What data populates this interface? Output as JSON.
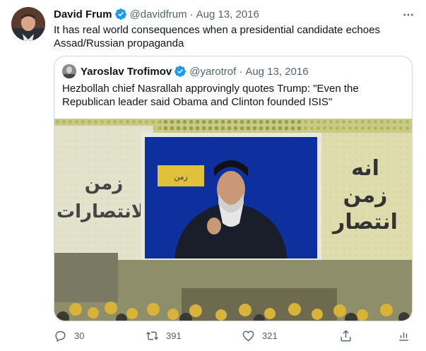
{
  "tweet": {
    "author_name": "David Frum",
    "handle": "@davidfrum",
    "separator": "·",
    "date": "Aug 13, 2016",
    "text": "It has real world consequences when a presidential candidate echoes Assad/Russian propaganda"
  },
  "quoted": {
    "author_name": "Yaroslav Trofimov",
    "handle": "@yarotrof",
    "separator": "·",
    "date": "Aug 13, 2016",
    "text": "Hezbollah chief Nasrallah approvingly quotes Trump: \"Even the Republican leader said Obama and Clinton founded ISIS\""
  },
  "actions": {
    "reply_count": "30",
    "retweet_count": "391",
    "like_count": "321"
  },
  "icons": [
    "verified-badge-icon",
    "more-icon",
    "reply-icon",
    "retweet-icon",
    "like-icon",
    "share-icon"
  ],
  "colors": {
    "text": "#0f1419",
    "secondary": "#536471",
    "verified": "#1d9bf0",
    "border": "#cfd9de"
  }
}
